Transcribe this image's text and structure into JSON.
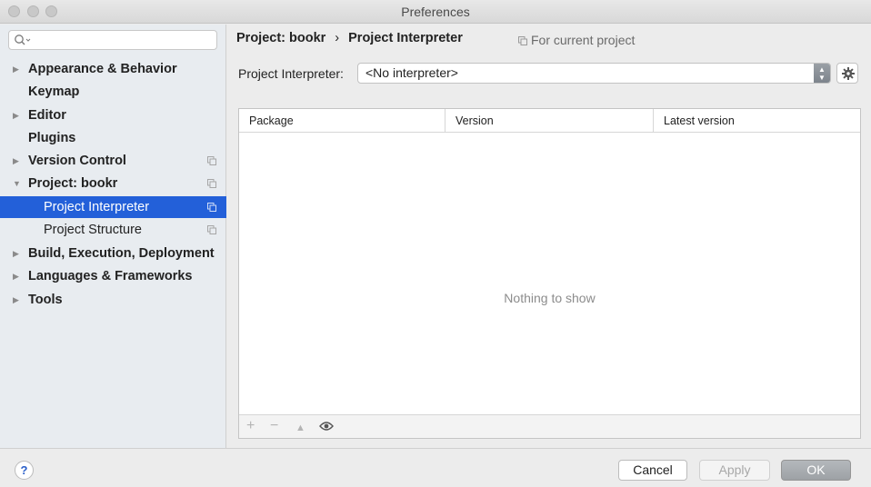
{
  "window": {
    "title": "Preferences"
  },
  "sidebar": {
    "search_placeholder": "",
    "items": [
      {
        "label": "Appearance & Behavior",
        "expandable": true,
        "expanded": false,
        "level": 0,
        "scope_icon": false
      },
      {
        "label": "Keymap",
        "expandable": false,
        "level": 0,
        "scope_icon": false
      },
      {
        "label": "Editor",
        "expandable": true,
        "expanded": false,
        "level": 0,
        "scope_icon": false
      },
      {
        "label": "Plugins",
        "expandable": false,
        "level": 0,
        "scope_icon": false
      },
      {
        "label": "Version Control",
        "expandable": true,
        "expanded": false,
        "level": 0,
        "scope_icon": true
      },
      {
        "label": "Project: bookr",
        "expandable": true,
        "expanded": true,
        "level": 0,
        "scope_icon": true
      },
      {
        "label": "Project Interpreter",
        "expandable": false,
        "level": 1,
        "selected": true,
        "scope_icon": true
      },
      {
        "label": "Project Structure",
        "expandable": false,
        "level": 1,
        "scope_icon": true
      },
      {
        "label": "Build, Execution, Deployment",
        "expandable": true,
        "expanded": false,
        "level": 0,
        "scope_icon": false
      },
      {
        "label": "Languages & Frameworks",
        "expandable": true,
        "expanded": false,
        "level": 0,
        "scope_icon": false
      },
      {
        "label": "Tools",
        "expandable": true,
        "expanded": false,
        "level": 0,
        "scope_icon": false
      }
    ]
  },
  "main": {
    "breadcrumb": {
      "parent": "Project: bookr",
      "separator": "›",
      "current": "Project Interpreter"
    },
    "scope_note": "For current project",
    "interpreter": {
      "label": "Project Interpreter:",
      "value": "<No interpreter>"
    },
    "table": {
      "columns": [
        "Package",
        "Version",
        "Latest version"
      ],
      "rows": [],
      "empty_text": "Nothing to show"
    },
    "toolbar": {
      "add": "+",
      "remove": "−",
      "upgrade": "▲"
    }
  },
  "footer": {
    "help": "?",
    "cancel_label": "Cancel",
    "apply_label": "Apply",
    "ok_label": "OK"
  },
  "colors": {
    "selection": "#2360d9",
    "sidebar_bg": "#e8ecf0",
    "help_accent": "#2a5fc9"
  }
}
